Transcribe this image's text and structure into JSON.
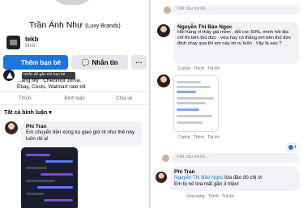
{
  "profile": {
    "name": "Trần Ánh Như",
    "name_suffix": "(Luxy Brands)",
    "page_name": "tekb",
    "page_sub": "Khói"
  },
  "buttons": {
    "add_friend": "Thêm bạn bè",
    "message": "Nhắn tin",
    "more": "···"
  },
  "tooltip": "Nhấn để gắn thẻ bạn bè",
  "post_lines": {
    "line1": "...ang Mỹ . Checkout Joma,",
    "line2": "Ebay, Costo, Walmart rate tốt"
  },
  "post_actions": {
    "like": "Thích",
    "comment": "Bình luận",
    "share": "Chia sẻ"
  },
  "sort_label": "Tất cả bình luận",
  "comments": [
    {
      "author": "Phi Tran",
      "text": "Em chuyển tiền xong ko giao giờ nt như thế này luôn rồi ạ!"
    }
  ],
  "right": {
    "reply_placeholder_1": "Viết câu trả lời...",
    "reply_author": "Nguyễn Thị Bảo Ngọc",
    "reply_text": "Hỏi hàng vì thấy giá mềm , đối cọc 50%, mình hỏi địa chỉ thì bên thủ đức - vừa hay có thằng em bên thủ đức định chạy qua thì em này im ru luôn . Vậy là sao ?",
    "reply_actions": {
      "time": "2 phút",
      "like": "Thích",
      "reply": "Trả lời"
    },
    "image_reply_actions": {
      "time": "2 phút",
      "like": "Thích",
      "reply": "Trả lời"
    },
    "reaction_count": "1",
    "reply_placeholder_2": "Viết câu trả lời...",
    "reply2_author": "Phi Tran",
    "reply2_mention": "Nguyễn Thị Bảo Ngọc",
    "reply2_text_after_mention": "lừa đảo đó chị ơi",
    "reply2_line2": "Em bị nó lừa mất gần 3 triệu!",
    "reply2_actions": {
      "time": "Vừa xong",
      "like": "Thích",
      "reply": "Trả lời"
    }
  }
}
